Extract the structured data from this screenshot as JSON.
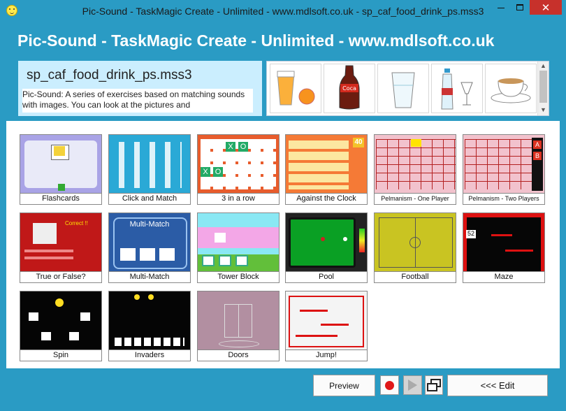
{
  "window": {
    "title": "Pic-Sound - TaskMagic Create - Unlimited - www.mdlsoft.co.uk - sp_caf_food_drink_ps.mss3",
    "controls": {
      "minimize": "minimize",
      "maximize": "maximize",
      "close": "✕"
    }
  },
  "header": {
    "heading": "Pic-Sound - TaskMagic Create - Unlimited - www.mdlsoft.co.uk",
    "file_name": "sp_caf_food_drink_ps.mss3",
    "description": "Pic-Sound: A series of exercises based on matching sounds with images. You can look at the pictures and",
    "pictures": [
      "orange-juice-and-orange",
      "cola-bottle",
      "glass-of-water",
      "water-bottle-and-glass",
      "cup-of-tea"
    ]
  },
  "games": [
    {
      "label": "Flashcards",
      "bg": "#a9a3e6"
    },
    {
      "label": "Click and Match",
      "bg": "#2aa9d6"
    },
    {
      "label": "3 in a row",
      "bg": "#e85c2c"
    },
    {
      "label": "Against the Clock",
      "bg": "#f57a36"
    },
    {
      "label": "Pelmanism - One Player",
      "bg": "#f2c2cd"
    },
    {
      "label": "Pelmanism - Two Players",
      "bg": "#f2c2cd"
    },
    {
      "label": "True or False?",
      "bg": "#c01818"
    },
    {
      "label": "Multi-Match",
      "bg": "#2b5ca6"
    },
    {
      "label": "Tower Block",
      "bg": "#8ae8f4"
    },
    {
      "label": "Pool",
      "bg": "#0aa024"
    },
    {
      "label": "Football",
      "bg": "#c9c422"
    },
    {
      "label": "Maze",
      "bg": "#060606"
    },
    {
      "label": "Spin",
      "bg": "#050505"
    },
    {
      "label": "Invaders",
      "bg": "#050505"
    },
    {
      "label": "Doors",
      "bg": "#b28fa1"
    },
    {
      "label": "Jump!",
      "bg": "#f4f4f4"
    }
  ],
  "footer": {
    "preview_label": "Preview",
    "edit_label": "<<<   Edit"
  }
}
